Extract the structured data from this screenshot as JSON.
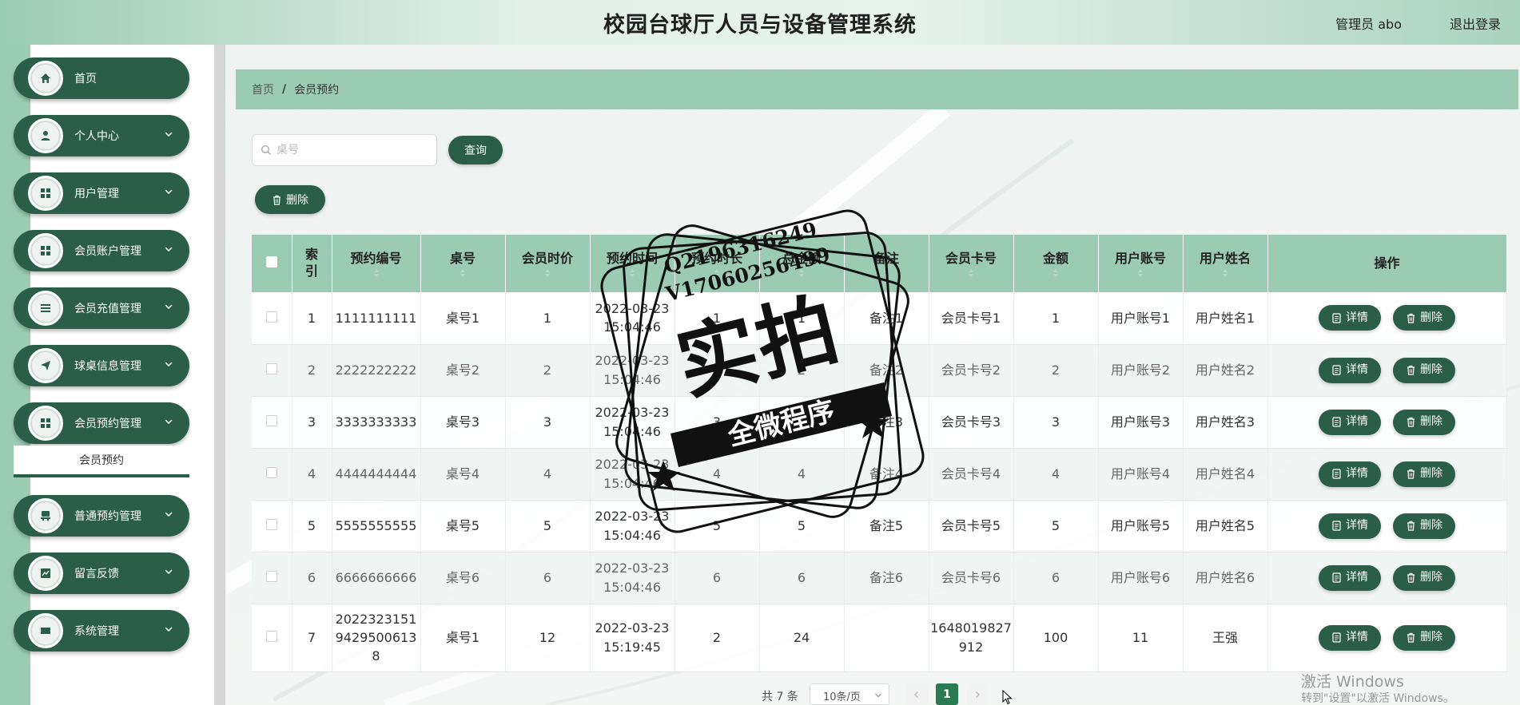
{
  "header": {
    "title": "校园台球厅人员与设备管理系统",
    "user": "管理员 abo",
    "logout": "退出登录"
  },
  "sidebar": {
    "items": [
      {
        "label": "首页",
        "icon": "home-icon"
      },
      {
        "label": "个人中心",
        "icon": "person-icon"
      },
      {
        "label": "用户管理",
        "icon": "grid-icon"
      },
      {
        "label": "会员账户管理",
        "icon": "grid-icon"
      },
      {
        "label": "会员充值管理",
        "icon": "list-icon"
      },
      {
        "label": "球桌信息管理",
        "icon": "send-icon"
      },
      {
        "label": "会员预约管理",
        "icon": "grid-icon"
      },
      {
        "label": "普通预约管理",
        "icon": "chair-icon"
      },
      {
        "label": "留言反馈",
        "icon": "chart-icon"
      },
      {
        "label": "系统管理",
        "icon": "ticket-icon"
      }
    ],
    "submenu_active": "会员预约"
  },
  "breadcrumb": {
    "home": "首页",
    "separator": "/",
    "current": "会员预约"
  },
  "search": {
    "placeholder": "桌号",
    "button": "查询"
  },
  "toolbar": {
    "delete_label": "删除"
  },
  "table": {
    "headers": [
      "索引",
      "预约编号",
      "桌号",
      "会员时价",
      "预约时间",
      "预约时长",
      "总金额",
      "备注",
      "会员卡号",
      "金额",
      "用户账号",
      "用户姓名",
      "操作"
    ],
    "rows": [
      [
        "1",
        "1111111111",
        "桌号1",
        "1",
        "2022-03-23 15:04:46",
        "1",
        "1",
        "备注1",
        "会员卡号1",
        "1",
        "用户账号1",
        "用户姓名1"
      ],
      [
        "2",
        "2222222222",
        "桌号2",
        "2",
        "2022-03-23 15:04:46",
        "2",
        "2",
        "备注2",
        "会员卡号2",
        "2",
        "用户账号2",
        "用户姓名2"
      ],
      [
        "3",
        "3333333333",
        "桌号3",
        "3",
        "2022-03-23 15:04:46",
        "3",
        "3",
        "备注3",
        "会员卡号3",
        "3",
        "用户账号3",
        "用户姓名3"
      ],
      [
        "4",
        "4444444444",
        "桌号4",
        "4",
        "2022-03-23 15:04:46",
        "4",
        "4",
        "备注4",
        "会员卡号4",
        "4",
        "用户账号4",
        "用户姓名4"
      ],
      [
        "5",
        "5555555555",
        "桌号5",
        "5",
        "2022-03-23 15:04:46",
        "5",
        "5",
        "备注5",
        "会员卡号5",
        "5",
        "用户账号5",
        "用户姓名5"
      ],
      [
        "6",
        "6666666666",
        "桌号6",
        "6",
        "2022-03-23 15:04:46",
        "6",
        "6",
        "备注6",
        "会员卡号6",
        "6",
        "用户账号6",
        "用户姓名6"
      ],
      [
        "7",
        "202232315194295006138",
        "桌号1",
        "12",
        "2022-03-23 15:19:45",
        "2",
        "24",
        "",
        "1648019827912",
        "100",
        "11",
        "王强"
      ]
    ],
    "detail_label": "详情",
    "delete_label": "删除"
  },
  "pagination": {
    "total": "共 7 条",
    "page_size": "10条/页",
    "current_page": "1"
  },
  "watermark": {
    "q": "Q2196316249",
    "v": "V17060256499",
    "big": "实拍",
    "band": "全微程序"
  },
  "os_watermark": {
    "line1": "激活 Windows",
    "line2": "转到\"设置\"以激活 Windows。"
  },
  "colors": {
    "primary": "#2b5e48",
    "accent_bg": "#9ccbb4",
    "page_active": "#2b7a52"
  }
}
